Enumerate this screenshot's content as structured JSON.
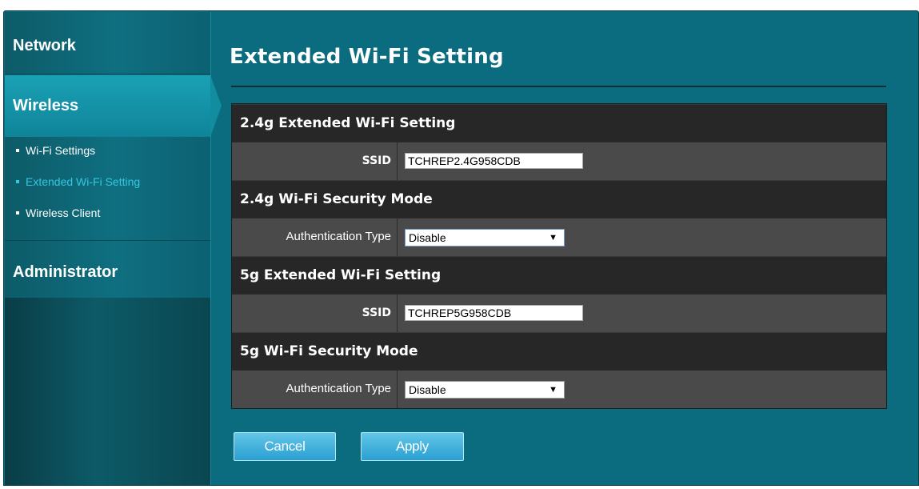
{
  "sidebar": {
    "network": "Network",
    "wireless": "Wireless",
    "submenu": [
      {
        "label": "Wi-Fi Settings"
      },
      {
        "label": "Extended Wi-Fi Setting"
      },
      {
        "label": "Wireless Client"
      }
    ],
    "administrator": "Administrator"
  },
  "page": {
    "title": "Extended Wi-Fi Setting"
  },
  "sections": [
    {
      "heading": "2.4g Extended Wi-Fi Setting",
      "field_label": "SSID",
      "value": "TCHREP2.4G958CDB"
    },
    {
      "heading": "2.4g Wi-Fi Security Mode",
      "field_label": "Authentication Type",
      "value": "Disable"
    },
    {
      "heading": "5g Extended Wi-Fi Setting",
      "field_label": "SSID",
      "value": "TCHREP5G958CDB"
    },
    {
      "heading": "5g Wi-Fi Security Mode",
      "field_label": "Authentication Type",
      "value": "Disable"
    }
  ],
  "buttons": {
    "cancel": "Cancel",
    "apply": "Apply"
  },
  "icons": {
    "bullet": "bullet-icon",
    "dropdown": "chevron-down-icon"
  },
  "colors": {
    "background": "#0b6c7f",
    "active_menu": "#35c7e0",
    "button": "#2a9fd2"
  }
}
